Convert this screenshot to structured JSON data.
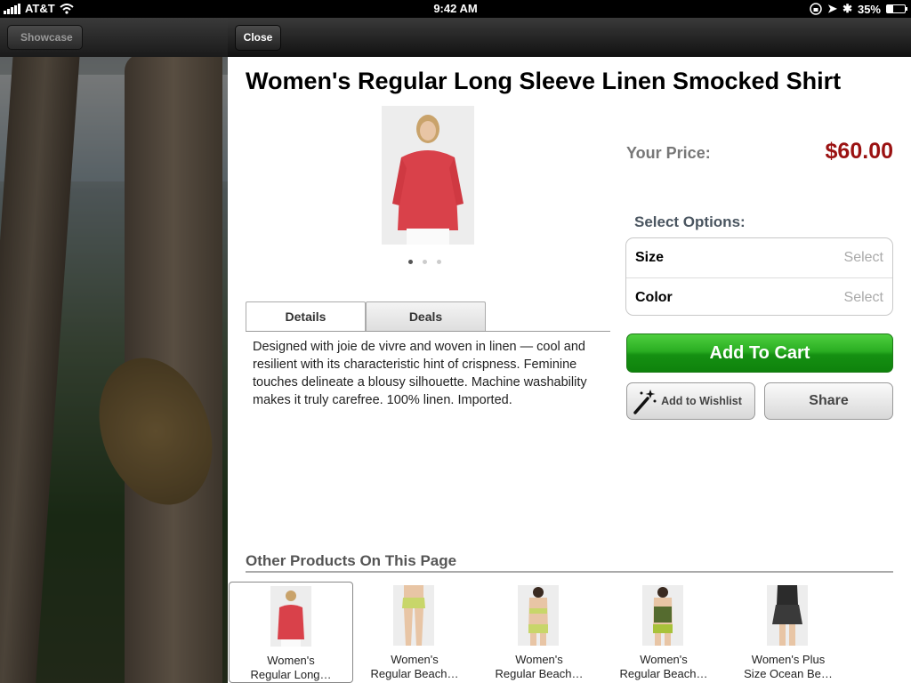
{
  "status": {
    "carrier": "AT&T",
    "time": "9:42 AM",
    "battery": "35%"
  },
  "nav": {
    "back_label": "Showcase",
    "close_label": "Close"
  },
  "product": {
    "title": "Women's Regular Long Sleeve Linen Smocked Shirt",
    "price_label": "Your Price:",
    "price": "$60.00",
    "image_pages": 3,
    "active_page": 1
  },
  "tabs": [
    {
      "label": "Details"
    },
    {
      "label": "Deals"
    }
  ],
  "description": "Designed with joie de vivre and woven in linen — cool and resilient with its characteristic hint of crispness. Feminine touches delineate a blousy silhouette. Machine washability makes it truly carefree. 100% linen. Imported.",
  "options": {
    "label": "Select Options:",
    "items": [
      {
        "name": "Size",
        "value": "Select"
      },
      {
        "name": "Color",
        "value": "Select"
      }
    ]
  },
  "actions": {
    "add_to_cart": "Add To Cart",
    "wishlist": "Add to Wishlist",
    "share": "Share"
  },
  "other": {
    "label": "Other Products On This Page",
    "items": [
      {
        "name": "Women's",
        "name2": "Regular Long…"
      },
      {
        "name": "Women's",
        "name2": "Regular Beach…"
      },
      {
        "name": "Women's",
        "name2": "Regular Beach…"
      },
      {
        "name": "Women's",
        "name2": "Regular Beach…"
      },
      {
        "name": "Women's Plus",
        "name2": "Size Ocean Be…"
      }
    ]
  },
  "colors": {
    "price": "#9b1212",
    "cart_green": "#2aae22"
  }
}
